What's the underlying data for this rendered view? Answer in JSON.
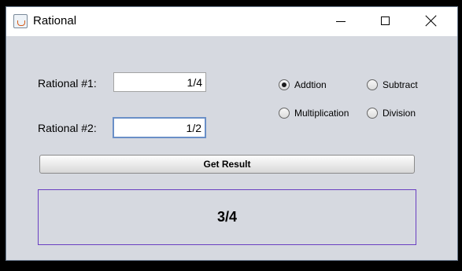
{
  "window": {
    "title": "Rational",
    "icon": "java-cup-icon"
  },
  "form": {
    "rational1_label": "Rational #1:",
    "rational1_value": "1/4",
    "rational2_label": "Rational #2:",
    "rational2_value": "1/2"
  },
  "operations": [
    {
      "label": "Addtion",
      "checked": true
    },
    {
      "label": "Subtract",
      "checked": false
    },
    {
      "label": "Multiplication",
      "checked": false
    },
    {
      "label": "Division",
      "checked": false
    }
  ],
  "actions": {
    "get_result_label": "Get Result"
  },
  "result": {
    "value": "3/4"
  }
}
